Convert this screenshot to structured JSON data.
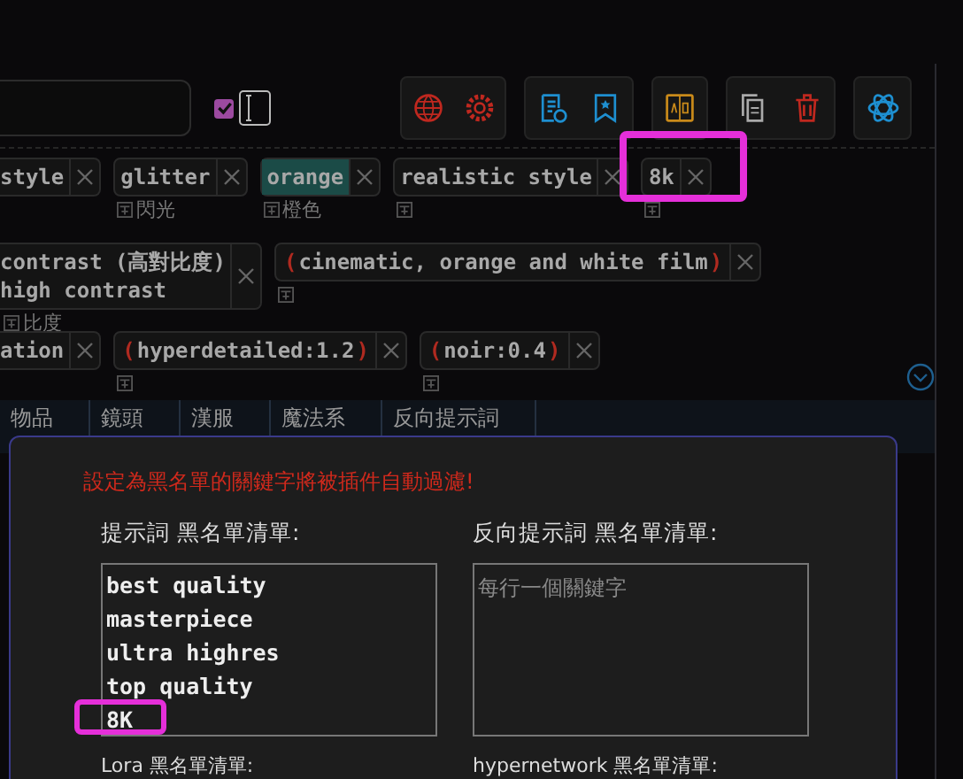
{
  "toolbar": {
    "search_checkbox": {
      "checked": true
    }
  },
  "tag_rows": [
    {
      "tags": [
        {
          "kind": "plain",
          "lines": [
            "style"
          ],
          "highlighted": false,
          "translated": false
        },
        {
          "kind": "plain",
          "lines": [
            "glitter"
          ],
          "highlighted": false,
          "translated": true,
          "translation": "閃光"
        },
        {
          "kind": "plain",
          "lines": [
            "orange"
          ],
          "highlighted": true,
          "translated": true,
          "translation": "橙色"
        },
        {
          "kind": "plain",
          "lines": [
            "realistic style"
          ],
          "highlighted": false,
          "translated": true
        },
        {
          "kind": "plain",
          "lines": [
            "8k"
          ],
          "highlighted": false,
          "translated": true
        }
      ]
    },
    {
      "tags": [
        {
          "kind": "plain",
          "lines": [
            "contrast (高對比度)",
            "high contrast"
          ],
          "highlighted": false,
          "translated": true,
          "translation": "比度"
        },
        {
          "kind": "weighted",
          "prefix": "(",
          "lines": [
            "cinematic, orange and white film"
          ],
          "suffix": ")",
          "highlighted": false,
          "translated": true
        }
      ]
    },
    {
      "tags": [
        {
          "kind": "plain",
          "lines": [
            "ation"
          ],
          "highlighted": false,
          "translated": false
        },
        {
          "kind": "weighted",
          "prefix": "(",
          "lines": [
            "hyperdetailed:1.2"
          ],
          "suffix": ")",
          "highlighted": false,
          "translated": true
        },
        {
          "kind": "weighted",
          "prefix": "(",
          "lines": [
            "noir:0.4"
          ],
          "suffix": ")",
          "highlighted": false,
          "translated": true
        }
      ]
    }
  ],
  "tabs": [
    {
      "label": "物品",
      "selected": false
    },
    {
      "label": "鏡頭",
      "selected": false
    },
    {
      "label": "漢服",
      "selected": false
    },
    {
      "label": "魔法系",
      "selected": false
    },
    {
      "label": "反向提示詞",
      "selected": false
    }
  ],
  "dialog": {
    "warning": "設定為黑名單的關鍵字將被插件自動過濾!",
    "lists": [
      {
        "label": "提示詞 黑名單清單:",
        "lines": [
          "best quality",
          "masterpiece",
          "ultra highres",
          "top quality",
          "8K"
        ]
      },
      {
        "label": "反向提示詞 黑名單清單:",
        "placeholder": "每行一個關鍵字"
      }
    ],
    "more_labels": [
      "Lora 黑名單清單:",
      "hypernetwork 黑名單清單:"
    ]
  }
}
